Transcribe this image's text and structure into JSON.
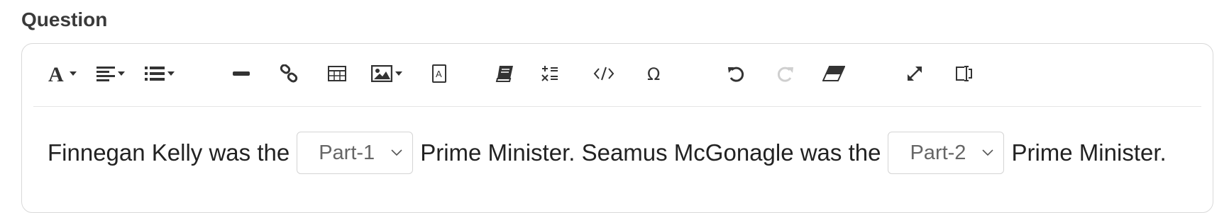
{
  "question_label": "Question",
  "toolbar": {
    "icons": [
      "font-icon",
      "align-icon",
      "list-icon",
      "horizontal-rule-icon",
      "link-icon",
      "table-icon",
      "image-icon",
      "text-box-icon",
      "book-icon",
      "math-icon",
      "code-icon",
      "omega-icon",
      "undo-icon",
      "redo-icon",
      "eraser-icon",
      "fullscreen-icon",
      "text-cursor-icon"
    ],
    "redo_disabled": true
  },
  "sentence": {
    "part1": "Finnegan Kelly was the",
    "select1_value": "Part-1",
    "part2": "Prime Minister. Seamus McGonagle was the",
    "select2_value": "Part-2",
    "part3": "Prime Minister."
  },
  "colors": {
    "text": "#222222",
    "muted": "#666666",
    "border": "#d9d9d9",
    "disabled_icon": "#cfcfcf"
  }
}
